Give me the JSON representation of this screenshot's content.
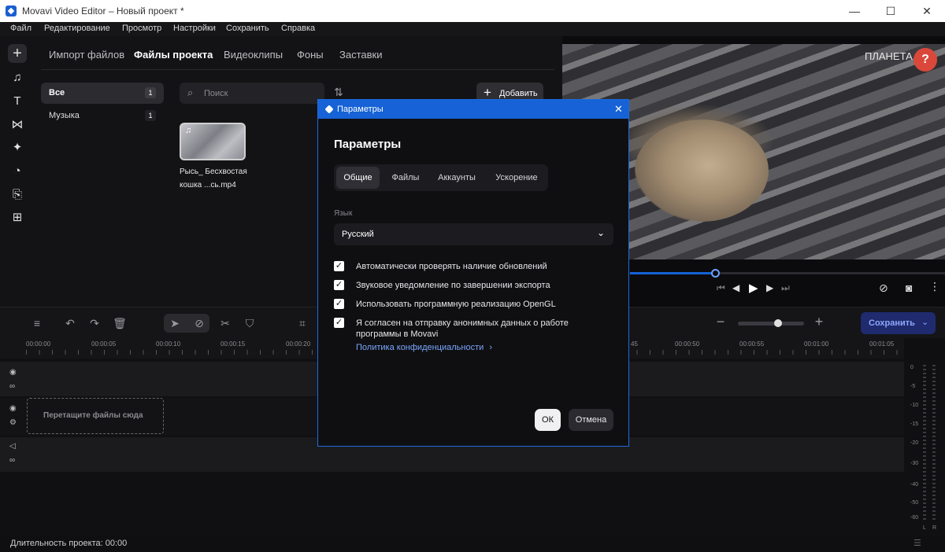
{
  "window": {
    "title": "Movavi Video Editor – Новый проект *",
    "minimize": "—",
    "maximize": "☐",
    "close": "✕"
  },
  "menu": [
    "Файл",
    "Редактирование",
    "Просмотр",
    "Настройки",
    "Сохранить",
    "Справка"
  ],
  "library": {
    "tabs": [
      "Импорт файлов",
      "Файлы проекта",
      "Видеоклипы",
      "Фоны",
      "Заставки"
    ],
    "active_tab": 1,
    "categories": [
      {
        "label": "Все",
        "count": "1"
      },
      {
        "label": "Музыка",
        "count": "1"
      }
    ],
    "search_placeholder": "Поиск",
    "add_label": "Добавить",
    "file": {
      "name_line1": "Рысь_ Бесхвостая",
      "name_line2": "кошка ...сь.mp4"
    }
  },
  "preview": {
    "watermark": "ПЛАНЕТА З",
    "help": "?"
  },
  "timeline": {
    "ruler": [
      "00:00:00",
      "00:00:05",
      "00:00:10",
      "00:00:15",
      "00:00:20",
      "45",
      "00:00:50",
      "00:00:55",
      "00:01:00",
      "00:01:05"
    ],
    "drop_hint": "Перетащите файлы сюда",
    "save_label": "Сохранить",
    "meter": [
      "0",
      "-5",
      "-10",
      "-15",
      "-20",
      "-30",
      "-40",
      "-50",
      "-60"
    ],
    "meter_lr": [
      "L",
      "R"
    ]
  },
  "status": {
    "duration": "Длительность проекта: 00:00"
  },
  "dialog": {
    "window_title": "Параметры",
    "heading": "Параметры",
    "tabs": [
      "Общие",
      "Файлы",
      "Аккаунты",
      "Ускорение"
    ],
    "language_label": "Язык",
    "language_value": "Русский",
    "options": [
      "Автоматически проверять наличие обновлений",
      "Звуковое уведомление по завершении экспорта",
      "Использовать программную реализацию OpenGL",
      "Я согласен на отправку анонимных данных о работе программы в Movavi"
    ],
    "privacy_link": "Политика конфиденциальности",
    "ok": "ОК",
    "cancel": "Отмена"
  },
  "colors": {
    "accent": "#1662d6",
    "save_button": "#1f2b6e",
    "link": "#7aa7ff"
  }
}
